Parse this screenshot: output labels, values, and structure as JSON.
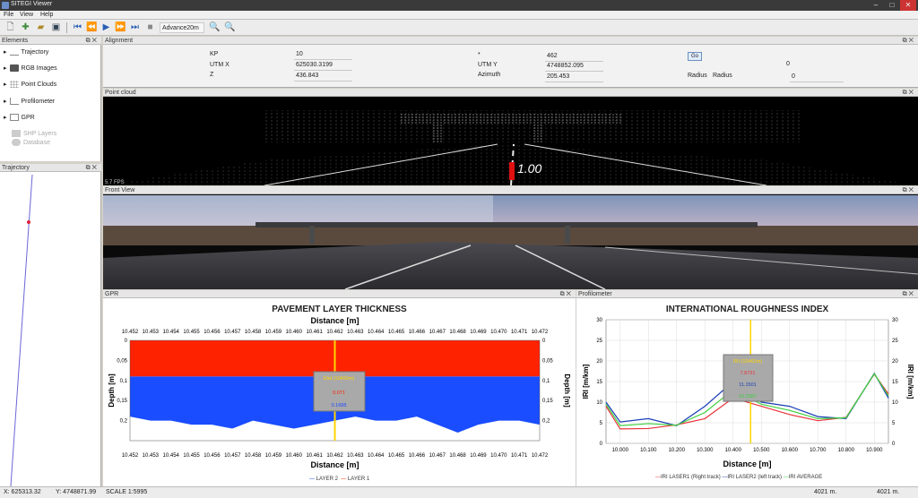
{
  "window": {
    "title": "SITEGI Viewer"
  },
  "menu": [
    "File",
    "View",
    "Help"
  ],
  "toolbar": {
    "advance": "Advance20m"
  },
  "elements": {
    "title": "Elements",
    "items": [
      "Trajectory",
      "RGB Images",
      "Point Clouds",
      "Profilometer",
      "GPR"
    ],
    "disabled": [
      "SHP Layers",
      "Database"
    ]
  },
  "trajectory_panel": {
    "title": "Trajectory"
  },
  "alignment": {
    "title": "Alignment",
    "kp_label": "KP",
    "kp": "10",
    "utmx_label": "UTM  X",
    "utmx": "625030.3199",
    "z_label": "Z",
    "z": "436.843",
    "star_label": "*",
    "star": "462",
    "utmy_label": "UTM Y",
    "utmy": "4748852.095",
    "azimuth_label": "Azimuth",
    "azimuth": "205.453",
    "go": "Go",
    "radius_label1": "Radius",
    "radius_label2": "Radius",
    "radius_top": "0",
    "radius": "0"
  },
  "pointcloud": {
    "title": "Point cloud",
    "overlay": "1.00",
    "fps": "5.7 FPS"
  },
  "frontview": {
    "title": "Front View"
  },
  "gpr": {
    "title": "GPR",
    "chart_title": "PAVEMENT LAYER THICKNESS",
    "legend": [
      "LAYER 2",
      "LAYER 1"
    ]
  },
  "profilometer": {
    "title": "Profilometer",
    "chart_title": "INTERNATIONAL ROUGHNESS INDEX",
    "legend": [
      "IRI LASER1 (Right track)",
      "IRI LASER2 (left track)",
      "IRI AVERAGE"
    ]
  },
  "status": {
    "x": "X: 625313.32",
    "y": "Y: 4748871.99",
    "scale": "SCALE 1:5995",
    "dist1": "4021 m.",
    "dist2": "4021 m."
  },
  "colors": {
    "layer1": "#ff2200",
    "layer2": "#1a4dff",
    "laser1": "#e8343a",
    "laser2": "#1a3db8",
    "average": "#3fcf3f",
    "cursor": "#ffd400"
  },
  "chart_data": [
    {
      "type": "area",
      "title": "PAVEMENT LAYER THICKNESS",
      "xlabel": "Distance [m]",
      "ylabel": "Depth [m]",
      "xlim": [
        10.452,
        10.472
      ],
      "ylim": [
        0,
        0.25
      ],
      "x_ticks": [
        "10.452",
        "10.453",
        "10.454",
        "10.455",
        "10.456",
        "10.457",
        "10.458",
        "10.459",
        "10.460",
        "10.461",
        "10.462",
        "10.463",
        "10.464",
        "10.465",
        "10.466",
        "10.467",
        "10.468",
        "10.469",
        "10.470",
        "10.471",
        "10.472"
      ],
      "y_ticks": [
        "0",
        "0,05",
        "0,1",
        "0,15",
        "0,2"
      ],
      "series": [
        {
          "name": "LAYER 1",
          "interface_depth": 0.09
        },
        {
          "name": "LAYER 2",
          "bottom_depth": [
            0.19,
            0.2,
            0.2,
            0.21,
            0.21,
            0.22,
            0.2,
            0.21,
            0.22,
            0.21,
            0.2,
            0.19,
            0.2,
            0.2,
            0.19,
            0.21,
            0.23,
            0.21,
            0.2,
            0.2,
            0.21
          ]
        }
      ],
      "tooltip": {
        "title": "Dist (10462m)",
        "l1": "0.071",
        "l2": "0.1688"
      },
      "cursor_x": 10.462
    },
    {
      "type": "line",
      "title": "INTERNATIONAL ROUGHNESS INDEX",
      "xlabel": "Distance [m]",
      "ylabel": "IRI [m/km]",
      "x": [
        9.95,
        10.0,
        10.1,
        10.2,
        10.3,
        10.4,
        10.5,
        10.6,
        10.7,
        10.8,
        10.9,
        10.95
      ],
      "x_ticks": [
        "10.000",
        "10.100",
        "10.200",
        "10.300",
        "10.400",
        "10.500",
        "10.600",
        "10.700",
        "10.800",
        "10.900"
      ],
      "y_ticks": [
        "0",
        "5",
        "10",
        "15",
        "20",
        "25",
        "30"
      ],
      "ylim": [
        0,
        30
      ],
      "series": [
        {
          "name": "IRI LASER1 (Right track)",
          "values": [
            9,
            3.5,
            3.6,
            4.5,
            6,
            11,
            9,
            7,
            5.5,
            6.3,
            16.8,
            12
          ]
        },
        {
          "name": "IRI LASER2 (left track)",
          "values": [
            10,
            5.2,
            6,
            4.3,
            9,
            15,
            10,
            9,
            6.5,
            6,
            17,
            11
          ]
        },
        {
          "name": "IRI AVERAGE",
          "values": [
            9.5,
            4.3,
            4.8,
            4.4,
            7.5,
            13,
            9.5,
            8,
            6,
            6.2,
            16.9,
            11.5
          ]
        }
      ],
      "tooltip": {
        "title": "IRI (10462m)",
        "l1": "7.8731",
        "l2": "11.1501",
        "avg": "10.2587"
      },
      "cursor_x": 10.462
    }
  ]
}
